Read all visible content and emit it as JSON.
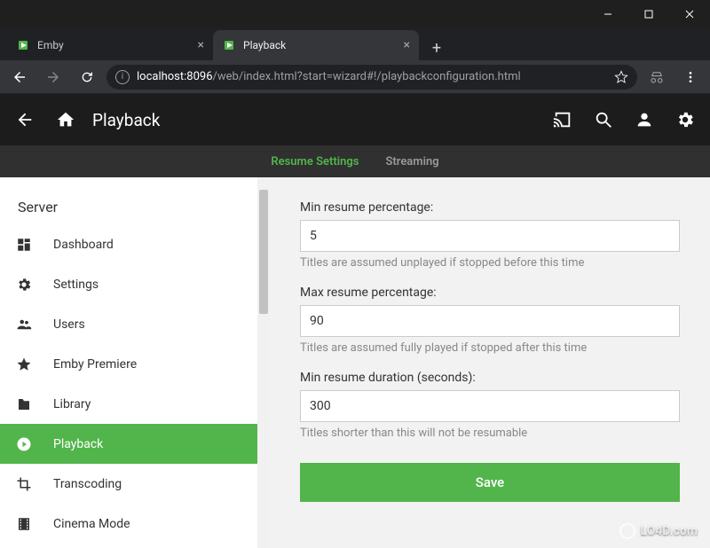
{
  "window": {
    "min": "—",
    "max": "☐",
    "close": "✕"
  },
  "browser": {
    "tabs": [
      {
        "label": "Emby"
      },
      {
        "label": "Playback"
      }
    ],
    "url_host": "localhost",
    "url_port": ":8096",
    "url_path": "/web/index.html?start=wizard#!/playbackconfiguration.html"
  },
  "header": {
    "title": "Playback"
  },
  "subtabs": {
    "resume": "Resume Settings",
    "streaming": "Streaming"
  },
  "sidebar": {
    "title": "Server",
    "items": [
      {
        "label": "Dashboard"
      },
      {
        "label": "Settings"
      },
      {
        "label": "Users"
      },
      {
        "label": "Emby Premiere"
      },
      {
        "label": "Library"
      },
      {
        "label": "Playback"
      },
      {
        "label": "Transcoding"
      },
      {
        "label": "Cinema Mode"
      }
    ]
  },
  "form": {
    "min_resume_pct": {
      "label": "Min resume percentage:",
      "value": "5",
      "help": "Titles are assumed unplayed if stopped before this time"
    },
    "max_resume_pct": {
      "label": "Max resume percentage:",
      "value": "90",
      "help": "Titles are assumed fully played if stopped after this time"
    },
    "min_resume_dur": {
      "label": "Min resume duration (seconds):",
      "value": "300",
      "help": "Titles shorter than this will not be resumable"
    },
    "save": "Save"
  },
  "watermark": "LO4D.com"
}
